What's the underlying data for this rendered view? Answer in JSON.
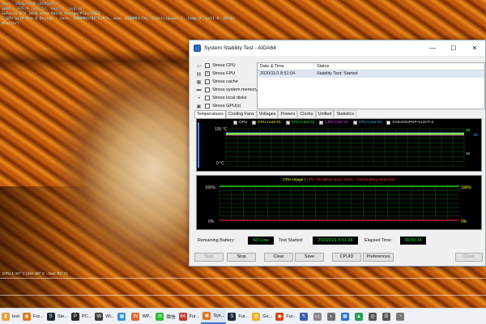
{
  "osd": {
    "line1": "test, 1920x1080 (0CMSAA)",
    "line2": "3000 - FPS:9 (min:57, max:72, avg:34)",
    "line3": "GeForce GTX 2070 with Max-Q Design/PCIe/SSE2",
    "line4": "[ GPU with Max-Q Design - core: 1080MHz/81°C/97%, mem: 1500MHz/3%, limits(power:1, temp:0, volt:0, OV:0)",
    "line5": "Monitor)",
    "line6": "",
    "gpu_graph_label": "GPU 1: 81° C (min: 56° C - max: 81° C)"
  },
  "window": {
    "title": "System Stability Test - AIDA64",
    "min_glyph": "—",
    "max_glyph": "☐",
    "close_glyph": "✕"
  },
  "stress": [
    {
      "label": "Stress CPU",
      "checked": false,
      "icon": "cpu-icon",
      "glyph": "▭"
    },
    {
      "label": "Stress FPU",
      "checked": true,
      "icon": "fpu-icon",
      "glyph": "▤"
    },
    {
      "label": "Stress cache",
      "checked": false,
      "icon": "cache-icon",
      "glyph": "▦"
    },
    {
      "label": "Stress system memory",
      "checked": false,
      "icon": "memory-icon",
      "glyph": "▬"
    },
    {
      "label": "Stress local disks",
      "checked": false,
      "icon": "disk-icon",
      "glyph": "◒"
    },
    {
      "label": "Stress GPU(s)",
      "checked": false,
      "icon": "gpu-icon",
      "glyph": "▣"
    }
  ],
  "check_glyph": "✓",
  "log": {
    "col1": "Date & Time",
    "col2": "Status",
    "rows": [
      {
        "time": "2020/11/1 8:51:04",
        "status": "Stability Test: Started"
      }
    ]
  },
  "tabs": [
    "Temperatures",
    "Cooling Fans",
    "Voltages",
    "Powers",
    "Clocks",
    "Unified",
    "Statistics"
  ],
  "temp_graph": {
    "legend": [
      {
        "label": "CPU",
        "color": "#ffffff",
        "checked": true
      },
      {
        "label": "CPU Core #1",
        "color": "#ffff00",
        "checked": true
      },
      {
        "label": "CPU Core #2",
        "color": "#22ff22",
        "checked": true
      },
      {
        "label": "CPU Core #3",
        "color": "#ff33ff",
        "checked": true
      },
      {
        "label": "CPU Core #4",
        "color": "#33ccff",
        "checked": true
      },
      {
        "label": "SSD2000PNP-512GT-S",
        "color": "#dddddd",
        "checked": false
      }
    ],
    "y_top": "100 °C",
    "y_bottom": "0 °C",
    "right_top": "98",
    "right_top_alt": "97",
    "right_mid": "29"
  },
  "cpu_graph": {
    "title_left": "CPU Usage",
    "title_sep": "|",
    "title_right": "CPU Throttling (max: 45%) - Overheating Detected!",
    "y_top": "100%",
    "y_bottom": "0%",
    "right_top": "100%",
    "right_bottom": "0%"
  },
  "status": {
    "battery_label": "Remaining Battery:",
    "battery_value": "AC Line",
    "started_label": "Test Started:",
    "started_value": "2020/11/1 8:51:04",
    "elapsed_label": "Elapsed Time:",
    "elapsed_value": "00:00:24"
  },
  "buttons": {
    "start": "Start",
    "stop": "Stop",
    "clear": "Clear",
    "save": "Save",
    "cpuid": "CPUID",
    "preferences": "Preferences",
    "close": "Close"
  },
  "taskbar": [
    {
      "label": "test",
      "color": "#e8a23a",
      "glyph": "▮",
      "icon": "folder-icon"
    },
    {
      "label": "Fur...",
      "color": "#e07a1a",
      "glyph": "◉",
      "icon": "furmark-icon"
    },
    {
      "label": "Ste...",
      "color": "#1b2838",
      "glyph": "S",
      "icon": "steam-icon"
    },
    {
      "label": "PC...",
      "color": "#2a2a2a",
      "glyph": "P",
      "icon": "pc-icon"
    },
    {
      "label": "Wi...",
      "color": "#3d3d3d",
      "glyph": "W",
      "icon": "window-icon"
    },
    {
      "label": "",
      "color": "#3a8fd8",
      "glyph": "▦",
      "icon": "app-icon-1"
    },
    {
      "label": "WP...",
      "color": "#e0652b",
      "glyph": "W",
      "icon": "wps-icon"
    },
    {
      "label": "微信",
      "color": "#2dbb3a",
      "glyph": "✉",
      "icon": "wechat-icon"
    },
    {
      "label": "Fur...",
      "color": "#c0392b",
      "glyph": "64",
      "icon": "aida64-icon"
    },
    {
      "label": "Sys...",
      "color": "#e07a1a",
      "glyph": "◉",
      "icon": "furmark-icon-2"
    },
    {
      "label": "Fur...",
      "color": "#1b2838",
      "glyph": "S",
      "icon": "steam-icon-2"
    },
    {
      "label": "Ge...",
      "color": "#f2b01e",
      "glyph": "◍",
      "icon": "chrome-icon"
    },
    {
      "label": "Fur...",
      "color": "#d9460f",
      "glyph": "◉",
      "icon": "furmark-icon-3"
    },
    {
      "label": "",
      "color": "#3a5ea8",
      "glyph": "✎",
      "icon": "app-icon-2"
    },
    {
      "label": "",
      "color": "#8a8a8a",
      "glyph": "▭",
      "icon": "app-icon-3"
    },
    {
      "label": "",
      "color": "#6f6f6f",
      "glyph": "◐",
      "icon": "app-icon-4"
    },
    {
      "label": "",
      "color": "#2a6fd6",
      "glyph": "▦",
      "icon": "app-icon-5"
    },
    {
      "label": "",
      "color": "#2c9c5a",
      "glyph": "▲",
      "icon": "app-icon-6"
    },
    {
      "label": "",
      "color": "#555555",
      "glyph": "◎",
      "icon": "app-icon-7"
    },
    {
      "label": "",
      "color": "#555555",
      "glyph": "☰",
      "icon": "app-icon-8"
    },
    {
      "label": "",
      "color": "#777777",
      "glyph": "◔",
      "icon": "app-icon-9"
    }
  ]
}
